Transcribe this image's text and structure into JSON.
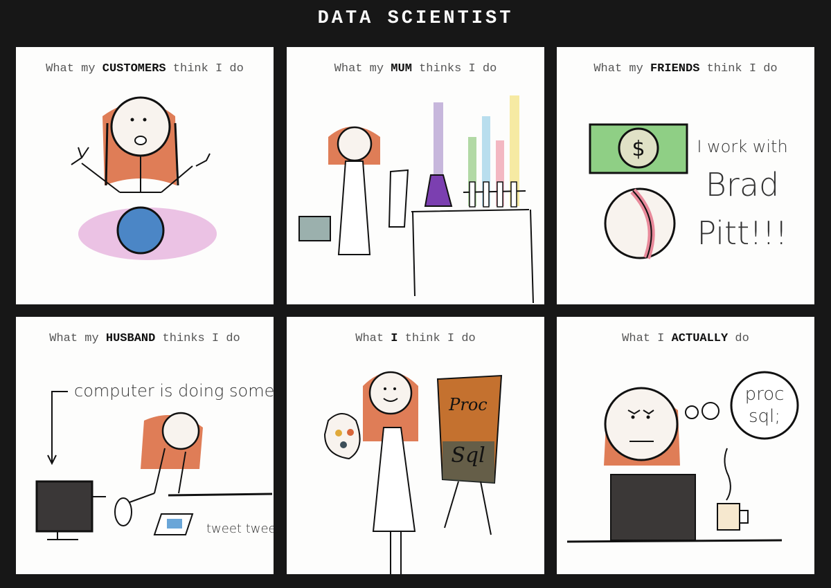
{
  "header": {
    "title": "DATA SCIENTIST"
  },
  "panels": [
    {
      "pre": "What my ",
      "emph": "CUSTOMERS",
      "post": " think I do",
      "scene": "fortune teller with crystal ball"
    },
    {
      "pre": "What my ",
      "emph": "MUM",
      "post": " thinks I do",
      "scene": "lab scientist with flask and test tubes"
    },
    {
      "pre": "What my ",
      "emph": "FRIENDS",
      "post": " think I do",
      "scene": "money and baseball",
      "text_lines": [
        "I work with",
        "Brad",
        "Pitt!!!"
      ]
    },
    {
      "pre": "What my ",
      "emph": "HUSBAND",
      "post": " thinks I do",
      "scene": "relaxing with feet up",
      "annotation": "computer is doing something",
      "tweet": "tweet tweet"
    },
    {
      "pre": "What ",
      "emph": "I",
      "post": " think I do",
      "scene": "painter at easel",
      "canvas_text": [
        "Proc",
        "Sql"
      ]
    },
    {
      "pre": "What I ",
      "emph": "ACTUALLY",
      "post": " do",
      "scene": "frowning at computer",
      "thought_lines": [
        "proc",
        "sql;"
      ]
    }
  ],
  "colors": {
    "background": "#171717",
    "panel": "#fdfdfc",
    "hair": "#d9663a",
    "ink": "#111111"
  }
}
